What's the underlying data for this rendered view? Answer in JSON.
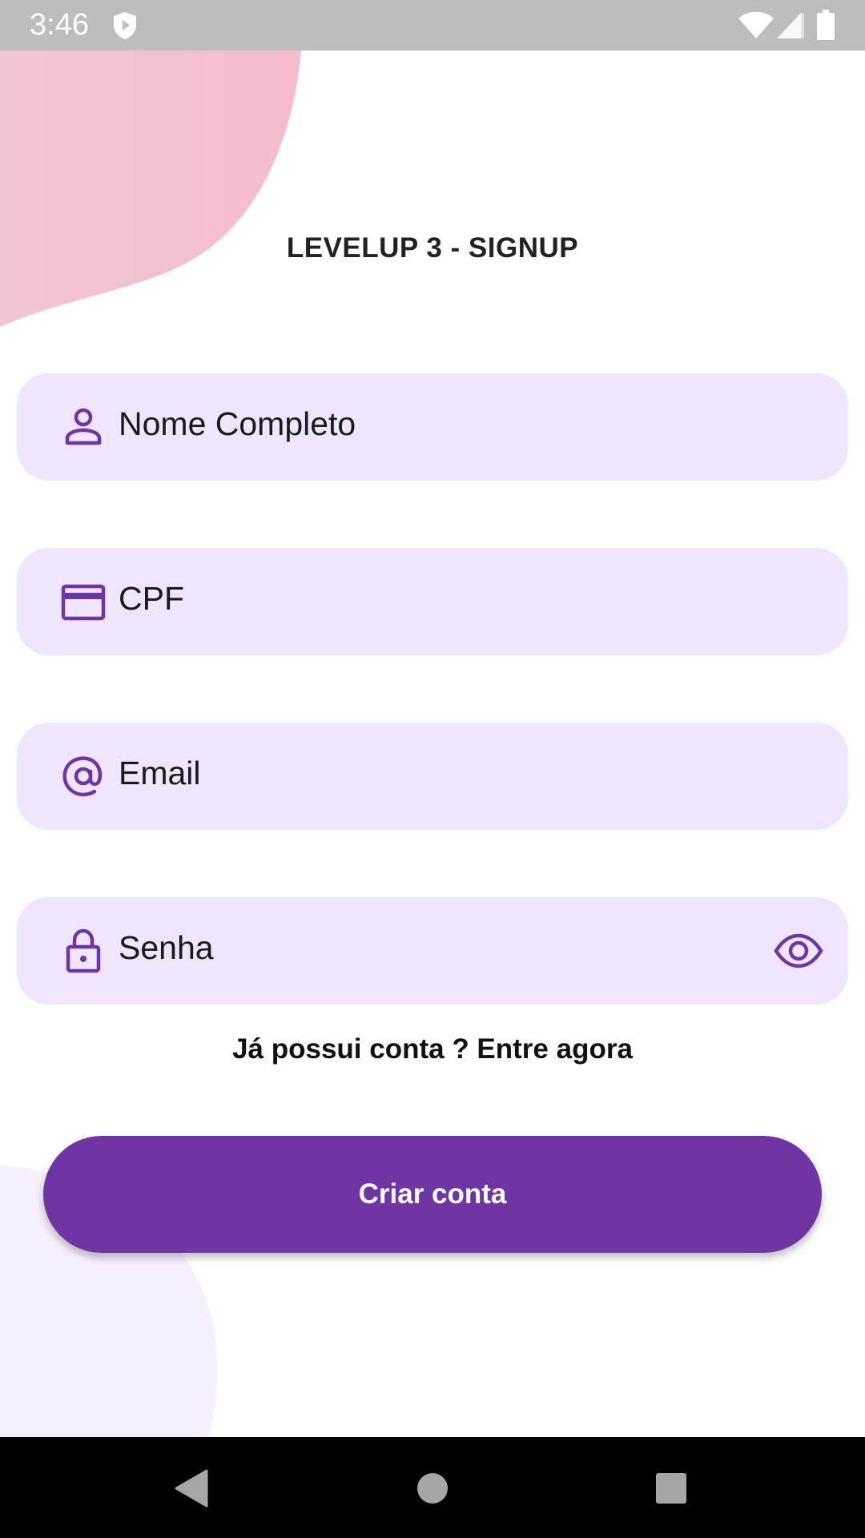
{
  "status_bar": {
    "time": "3:46",
    "icons": [
      "shield-icon",
      "wifi-icon",
      "signal-icon",
      "battery-icon"
    ]
  },
  "page": {
    "title": "LEVELUP 3 - SIGNUP"
  },
  "form": {
    "fields": [
      {
        "icon": "person-icon",
        "placeholder": "Nome Completo"
      },
      {
        "icon": "credit-card-icon",
        "placeholder": "CPF"
      },
      {
        "icon": "at-sign-icon",
        "placeholder": "Email"
      },
      {
        "icon": "lock-icon",
        "placeholder": "Senha",
        "trailing_icon": "eye-icon"
      }
    ],
    "login_link": "Já possui conta ? Entre agora",
    "submit_label": "Criar conta"
  },
  "nav_bar": {
    "icons": [
      "back-icon",
      "home-icon",
      "recents-icon"
    ]
  },
  "colors": {
    "accent": "#6f35a5",
    "field_background": "#efe5fd",
    "blob_top": "#f2c0cf",
    "blob_bottom": "#f6effc",
    "status_bar": "#bdbdbd"
  }
}
